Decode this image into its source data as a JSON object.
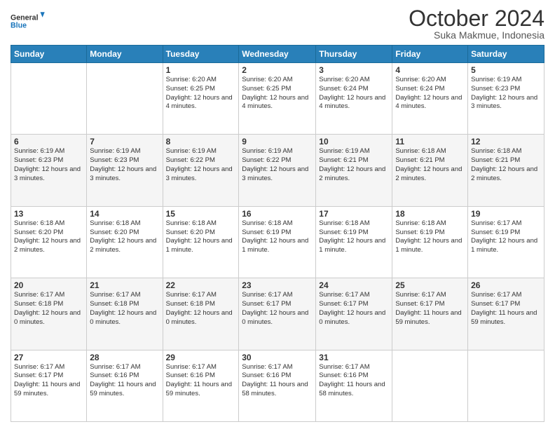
{
  "logo": {
    "line1": "General",
    "line2": "Blue"
  },
  "header": {
    "month": "October 2024",
    "location": "Suka Makmue, Indonesia"
  },
  "weekdays": [
    "Sunday",
    "Monday",
    "Tuesday",
    "Wednesday",
    "Thursday",
    "Friday",
    "Saturday"
  ],
  "weeks": [
    [
      {
        "day": "",
        "info": ""
      },
      {
        "day": "",
        "info": ""
      },
      {
        "day": "1",
        "info": "Sunrise: 6:20 AM\nSunset: 6:25 PM\nDaylight: 12 hours and 4 minutes."
      },
      {
        "day": "2",
        "info": "Sunrise: 6:20 AM\nSunset: 6:25 PM\nDaylight: 12 hours and 4 minutes."
      },
      {
        "day": "3",
        "info": "Sunrise: 6:20 AM\nSunset: 6:24 PM\nDaylight: 12 hours and 4 minutes."
      },
      {
        "day": "4",
        "info": "Sunrise: 6:20 AM\nSunset: 6:24 PM\nDaylight: 12 hours and 4 minutes."
      },
      {
        "day": "5",
        "info": "Sunrise: 6:19 AM\nSunset: 6:23 PM\nDaylight: 12 hours and 3 minutes."
      }
    ],
    [
      {
        "day": "6",
        "info": "Sunrise: 6:19 AM\nSunset: 6:23 PM\nDaylight: 12 hours and 3 minutes."
      },
      {
        "day": "7",
        "info": "Sunrise: 6:19 AM\nSunset: 6:23 PM\nDaylight: 12 hours and 3 minutes."
      },
      {
        "day": "8",
        "info": "Sunrise: 6:19 AM\nSunset: 6:22 PM\nDaylight: 12 hours and 3 minutes."
      },
      {
        "day": "9",
        "info": "Sunrise: 6:19 AM\nSunset: 6:22 PM\nDaylight: 12 hours and 3 minutes."
      },
      {
        "day": "10",
        "info": "Sunrise: 6:19 AM\nSunset: 6:21 PM\nDaylight: 12 hours and 2 minutes."
      },
      {
        "day": "11",
        "info": "Sunrise: 6:18 AM\nSunset: 6:21 PM\nDaylight: 12 hours and 2 minutes."
      },
      {
        "day": "12",
        "info": "Sunrise: 6:18 AM\nSunset: 6:21 PM\nDaylight: 12 hours and 2 minutes."
      }
    ],
    [
      {
        "day": "13",
        "info": "Sunrise: 6:18 AM\nSunset: 6:20 PM\nDaylight: 12 hours and 2 minutes."
      },
      {
        "day": "14",
        "info": "Sunrise: 6:18 AM\nSunset: 6:20 PM\nDaylight: 12 hours and 2 minutes."
      },
      {
        "day": "15",
        "info": "Sunrise: 6:18 AM\nSunset: 6:20 PM\nDaylight: 12 hours and 1 minute."
      },
      {
        "day": "16",
        "info": "Sunrise: 6:18 AM\nSunset: 6:19 PM\nDaylight: 12 hours and 1 minute."
      },
      {
        "day": "17",
        "info": "Sunrise: 6:18 AM\nSunset: 6:19 PM\nDaylight: 12 hours and 1 minute."
      },
      {
        "day": "18",
        "info": "Sunrise: 6:18 AM\nSunset: 6:19 PM\nDaylight: 12 hours and 1 minute."
      },
      {
        "day": "19",
        "info": "Sunrise: 6:17 AM\nSunset: 6:19 PM\nDaylight: 12 hours and 1 minute."
      }
    ],
    [
      {
        "day": "20",
        "info": "Sunrise: 6:17 AM\nSunset: 6:18 PM\nDaylight: 12 hours and 0 minutes."
      },
      {
        "day": "21",
        "info": "Sunrise: 6:17 AM\nSunset: 6:18 PM\nDaylight: 12 hours and 0 minutes."
      },
      {
        "day": "22",
        "info": "Sunrise: 6:17 AM\nSunset: 6:18 PM\nDaylight: 12 hours and 0 minutes."
      },
      {
        "day": "23",
        "info": "Sunrise: 6:17 AM\nSunset: 6:17 PM\nDaylight: 12 hours and 0 minutes."
      },
      {
        "day": "24",
        "info": "Sunrise: 6:17 AM\nSunset: 6:17 PM\nDaylight: 12 hours and 0 minutes."
      },
      {
        "day": "25",
        "info": "Sunrise: 6:17 AM\nSunset: 6:17 PM\nDaylight: 11 hours and 59 minutes."
      },
      {
        "day": "26",
        "info": "Sunrise: 6:17 AM\nSunset: 6:17 PM\nDaylight: 11 hours and 59 minutes."
      }
    ],
    [
      {
        "day": "27",
        "info": "Sunrise: 6:17 AM\nSunset: 6:17 PM\nDaylight: 11 hours and 59 minutes."
      },
      {
        "day": "28",
        "info": "Sunrise: 6:17 AM\nSunset: 6:16 PM\nDaylight: 11 hours and 59 minutes."
      },
      {
        "day": "29",
        "info": "Sunrise: 6:17 AM\nSunset: 6:16 PM\nDaylight: 11 hours and 59 minutes."
      },
      {
        "day": "30",
        "info": "Sunrise: 6:17 AM\nSunset: 6:16 PM\nDaylight: 11 hours and 58 minutes."
      },
      {
        "day": "31",
        "info": "Sunrise: 6:17 AM\nSunset: 6:16 PM\nDaylight: 11 hours and 58 minutes."
      },
      {
        "day": "",
        "info": ""
      },
      {
        "day": "",
        "info": ""
      }
    ]
  ]
}
